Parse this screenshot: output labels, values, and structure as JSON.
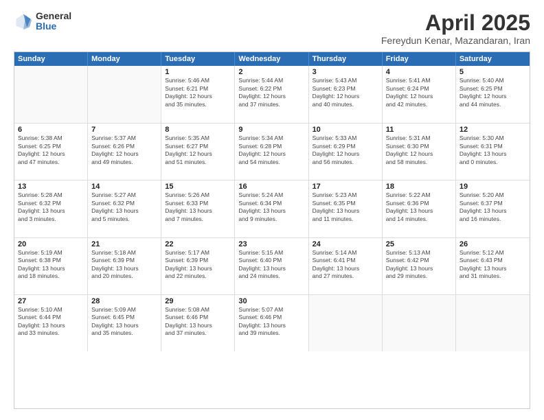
{
  "logo": {
    "general": "General",
    "blue": "Blue"
  },
  "title": {
    "month": "April 2025",
    "location": "Fereydun Kenar, Mazandaran, Iran"
  },
  "header_days": [
    "Sunday",
    "Monday",
    "Tuesday",
    "Wednesday",
    "Thursday",
    "Friday",
    "Saturday"
  ],
  "weeks": [
    [
      {
        "date": "",
        "info": ""
      },
      {
        "date": "",
        "info": ""
      },
      {
        "date": "1",
        "info": "Sunrise: 5:46 AM\nSunset: 6:21 PM\nDaylight: 12 hours\nand 35 minutes."
      },
      {
        "date": "2",
        "info": "Sunrise: 5:44 AM\nSunset: 6:22 PM\nDaylight: 12 hours\nand 37 minutes."
      },
      {
        "date": "3",
        "info": "Sunrise: 5:43 AM\nSunset: 6:23 PM\nDaylight: 12 hours\nand 40 minutes."
      },
      {
        "date": "4",
        "info": "Sunrise: 5:41 AM\nSunset: 6:24 PM\nDaylight: 12 hours\nand 42 minutes."
      },
      {
        "date": "5",
        "info": "Sunrise: 5:40 AM\nSunset: 6:25 PM\nDaylight: 12 hours\nand 44 minutes."
      }
    ],
    [
      {
        "date": "6",
        "info": "Sunrise: 5:38 AM\nSunset: 6:25 PM\nDaylight: 12 hours\nand 47 minutes."
      },
      {
        "date": "7",
        "info": "Sunrise: 5:37 AM\nSunset: 6:26 PM\nDaylight: 12 hours\nand 49 minutes."
      },
      {
        "date": "8",
        "info": "Sunrise: 5:35 AM\nSunset: 6:27 PM\nDaylight: 12 hours\nand 51 minutes."
      },
      {
        "date": "9",
        "info": "Sunrise: 5:34 AM\nSunset: 6:28 PM\nDaylight: 12 hours\nand 54 minutes."
      },
      {
        "date": "10",
        "info": "Sunrise: 5:33 AM\nSunset: 6:29 PM\nDaylight: 12 hours\nand 56 minutes."
      },
      {
        "date": "11",
        "info": "Sunrise: 5:31 AM\nSunset: 6:30 PM\nDaylight: 12 hours\nand 58 minutes."
      },
      {
        "date": "12",
        "info": "Sunrise: 5:30 AM\nSunset: 6:31 PM\nDaylight: 13 hours\nand 0 minutes."
      }
    ],
    [
      {
        "date": "13",
        "info": "Sunrise: 5:28 AM\nSunset: 6:32 PM\nDaylight: 13 hours\nand 3 minutes."
      },
      {
        "date": "14",
        "info": "Sunrise: 5:27 AM\nSunset: 6:32 PM\nDaylight: 13 hours\nand 5 minutes."
      },
      {
        "date": "15",
        "info": "Sunrise: 5:26 AM\nSunset: 6:33 PM\nDaylight: 13 hours\nand 7 minutes."
      },
      {
        "date": "16",
        "info": "Sunrise: 5:24 AM\nSunset: 6:34 PM\nDaylight: 13 hours\nand 9 minutes."
      },
      {
        "date": "17",
        "info": "Sunrise: 5:23 AM\nSunset: 6:35 PM\nDaylight: 13 hours\nand 11 minutes."
      },
      {
        "date": "18",
        "info": "Sunrise: 5:22 AM\nSunset: 6:36 PM\nDaylight: 13 hours\nand 14 minutes."
      },
      {
        "date": "19",
        "info": "Sunrise: 5:20 AM\nSunset: 6:37 PM\nDaylight: 13 hours\nand 16 minutes."
      }
    ],
    [
      {
        "date": "20",
        "info": "Sunrise: 5:19 AM\nSunset: 6:38 PM\nDaylight: 13 hours\nand 18 minutes."
      },
      {
        "date": "21",
        "info": "Sunrise: 5:18 AM\nSunset: 6:39 PM\nDaylight: 13 hours\nand 20 minutes."
      },
      {
        "date": "22",
        "info": "Sunrise: 5:17 AM\nSunset: 6:39 PM\nDaylight: 13 hours\nand 22 minutes."
      },
      {
        "date": "23",
        "info": "Sunrise: 5:15 AM\nSunset: 6:40 PM\nDaylight: 13 hours\nand 24 minutes."
      },
      {
        "date": "24",
        "info": "Sunrise: 5:14 AM\nSunset: 6:41 PM\nDaylight: 13 hours\nand 27 minutes."
      },
      {
        "date": "25",
        "info": "Sunrise: 5:13 AM\nSunset: 6:42 PM\nDaylight: 13 hours\nand 29 minutes."
      },
      {
        "date": "26",
        "info": "Sunrise: 5:12 AM\nSunset: 6:43 PM\nDaylight: 13 hours\nand 31 minutes."
      }
    ],
    [
      {
        "date": "27",
        "info": "Sunrise: 5:10 AM\nSunset: 6:44 PM\nDaylight: 13 hours\nand 33 minutes."
      },
      {
        "date": "28",
        "info": "Sunrise: 5:09 AM\nSunset: 6:45 PM\nDaylight: 13 hours\nand 35 minutes."
      },
      {
        "date": "29",
        "info": "Sunrise: 5:08 AM\nSunset: 6:46 PM\nDaylight: 13 hours\nand 37 minutes."
      },
      {
        "date": "30",
        "info": "Sunrise: 5:07 AM\nSunset: 6:46 PM\nDaylight: 13 hours\nand 39 minutes."
      },
      {
        "date": "",
        "info": ""
      },
      {
        "date": "",
        "info": ""
      },
      {
        "date": "",
        "info": ""
      }
    ]
  ]
}
